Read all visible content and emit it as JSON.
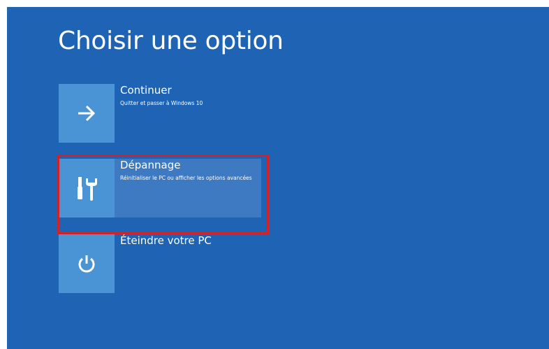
{
  "page": {
    "title": "Choisir une option"
  },
  "options": [
    {
      "title": "Continuer",
      "description": "Quitter et passer à Windows 10",
      "icon": "arrow-right-icon"
    },
    {
      "title": "Dépannage",
      "description": "Réinitialiser le PC ou afficher les options avancées",
      "icon": "tools-icon",
      "selected": true
    },
    {
      "title": "Éteindre votre PC",
      "description": "",
      "icon": "power-icon"
    }
  ],
  "colors": {
    "background": "#1e63b4",
    "tile": "#4a94d6",
    "selected_row": "#3d7ac2",
    "highlight_border": "#d32128"
  }
}
